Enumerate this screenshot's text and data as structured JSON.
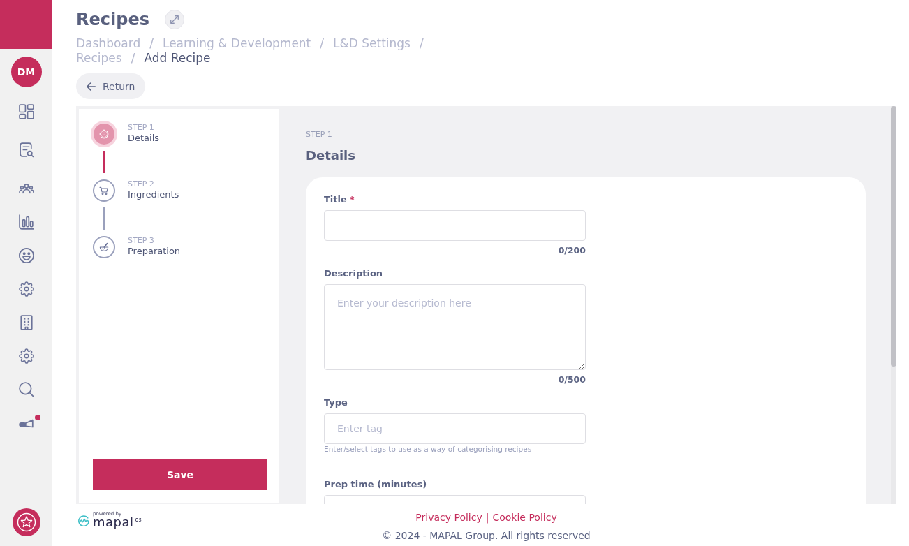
{
  "sidebar": {
    "avatar": {
      "initials": "DM"
    },
    "nav_items": [
      {
        "badge": false
      },
      {
        "badge": false
      },
      {
        "badge": false
      },
      {
        "badge": false
      },
      {
        "badge": false
      },
      {
        "badge": false
      },
      {
        "badge": false
      },
      {
        "badge": false
      },
      {
        "badge": false
      },
      {
        "badge": true
      }
    ]
  },
  "header": {
    "title": "Recipes",
    "breadcrumbs": [
      {
        "label": "Dashboard",
        "separator": "/",
        "current": false
      },
      {
        "label": "Learning & Development",
        "separator": "/",
        "current": false
      },
      {
        "label": "L&D Settings",
        "separator": "/",
        "current": false
      },
      {
        "label": "Recipes",
        "separator": "/",
        "current": false
      },
      {
        "label": "Add Recipe",
        "current": true
      }
    ],
    "return_button": {
      "label": "Return"
    }
  },
  "steps": [
    {
      "step_label": "STEP 1",
      "title": "Details",
      "selected": true
    },
    {
      "step_label": "STEP 2",
      "title": "Ingredients",
      "selected": false
    },
    {
      "step_label": "STEP 3",
      "title": "Preparation",
      "selected": false
    }
  ],
  "save_button": {
    "label": "Save"
  },
  "form": {
    "step_label": "STEP 1",
    "heading": "Details",
    "fields": [
      {
        "kind": "text",
        "label": "Title",
        "required_mark": "*",
        "counter": "0/200"
      },
      {
        "kind": "textarea",
        "label": "Description",
        "placeholder": "Enter your description here",
        "counter": "0/500"
      },
      {
        "kind": "tag",
        "label": "Type",
        "placeholder": "Enter tag",
        "hint": "Enter/select tags to use as a way of categorising recipes"
      },
      {
        "kind": "text",
        "label": "Prep time (minutes)"
      }
    ]
  },
  "footer": {
    "logo": {
      "caption": "powered by",
      "wordmark": "mapal",
      "suffix": "os"
    },
    "links": [
      {
        "label": "Privacy Policy"
      },
      {
        "label": "Cookie Policy"
      }
    ],
    "link_separator": "|",
    "copyright": "© 2024 - MAPAL Group. All rights reserved"
  }
}
